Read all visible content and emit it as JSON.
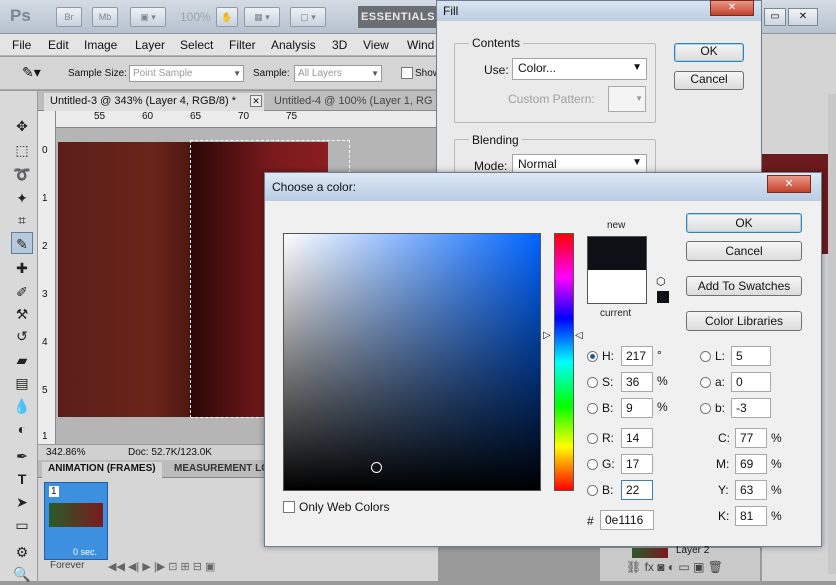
{
  "app": {
    "logo": "Ps",
    "zoom": "100%",
    "workspace": "ESSENTIALS",
    "title_btn1": "Br",
    "title_btn2": "Mb"
  },
  "menu": [
    "File",
    "Edit",
    "Image",
    "Layer",
    "Select",
    "Filter",
    "Analysis",
    "3D",
    "View",
    "Wind"
  ],
  "options": {
    "sample_size_label": "Sample Size:",
    "sample_size_value": "Point Sample",
    "sample_label": "Sample:",
    "sample_value": "All Layers",
    "show_label": "Show"
  },
  "tabs": [
    {
      "label": "Untitled-3 @ 343% (Layer 4, RGB/8) *"
    },
    {
      "label": "Untitled-4 @ 100% (Layer 1, RG"
    }
  ],
  "ruler": {
    "h": [
      "55",
      "60",
      "65",
      "70",
      "75"
    ],
    "v": [
      "0",
      "1",
      "2",
      "3",
      "4",
      "5",
      "1"
    ]
  },
  "status": {
    "zoom": "342.86%",
    "doc": "Doc: 52.7K/123.0K"
  },
  "animation": {
    "tab1": "ANIMATION (FRAMES)",
    "tab2": "MEASUREMENT LO",
    "frame_number": "1",
    "frame_delay": "0 sec.",
    "loop": "Forever"
  },
  "fill_dialog": {
    "title": "Fill",
    "contents_label": "Contents",
    "use_label": "Use:",
    "use_value": "Color...",
    "custom_pattern_label": "Custom Pattern:",
    "blending_label": "Blending",
    "mode_label": "Mode:",
    "mode_value": "Normal",
    "ok": "OK",
    "cancel": "Cancel"
  },
  "layers_panel": {
    "layer_name": "Layer 2"
  },
  "color_picker": {
    "title": "Choose a color:",
    "new_label": "new",
    "current_label": "current",
    "ok": "OK",
    "cancel": "Cancel",
    "add_swatches": "Add To Swatches",
    "color_libraries": "Color Libraries",
    "only_web_colors": "Only Web Colors",
    "new_color": "#0e1116",
    "current_color": "#ffffff",
    "H": {
      "label": "H:",
      "value": "217",
      "unit": "°"
    },
    "S": {
      "label": "S:",
      "value": "36",
      "unit": "%"
    },
    "B": {
      "label": "B:",
      "value": "9",
      "unit": "%"
    },
    "R": {
      "label": "R:",
      "value": "14"
    },
    "G": {
      "label": "G:",
      "value": "17"
    },
    "Bl": {
      "label": "B:",
      "value": "22"
    },
    "L": {
      "label": "L:",
      "value": "5"
    },
    "a": {
      "label": "a:",
      "value": "0"
    },
    "b": {
      "label": "b:",
      "value": "-3"
    },
    "C": {
      "label": "C:",
      "value": "77",
      "unit": "%"
    },
    "M": {
      "label": "M:",
      "value": "69",
      "unit": "%"
    },
    "Y": {
      "label": "Y:",
      "value": "63",
      "unit": "%"
    },
    "K": {
      "label": "K:",
      "value": "81",
      "unit": "%"
    },
    "hex_label": "#",
    "hex": "0e1116"
  }
}
